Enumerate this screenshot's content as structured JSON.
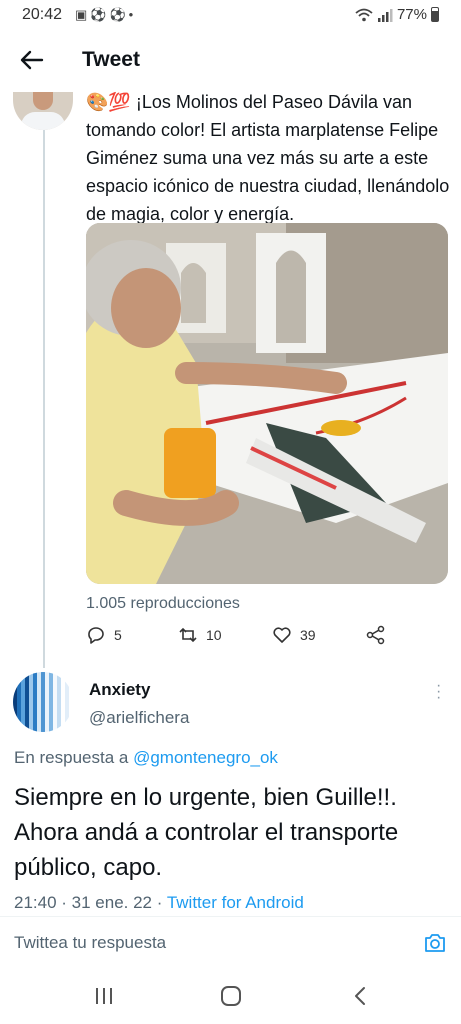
{
  "status_bar": {
    "time": "20:42",
    "left_icons": [
      "image-icon",
      "soccer-ball-icon",
      "soccer-ball-icon",
      "dot-icon"
    ],
    "battery": "77%"
  },
  "header": {
    "title": "Tweet",
    "back_icon": "back-arrow-icon"
  },
  "parent_tweet": {
    "emoji": "🎨💯",
    "text": "¡Los Molinos del Paseo Dávila van tomando color! El artista marplatense Felipe Giménez suma una vez más su arte a este espacio icónico de nuestra ciudad, llenándolo de magia, color y energía.",
    "views": "1.005 reproducciones",
    "replies": "5",
    "retweets": "10",
    "likes": "39"
  },
  "reply_tweet": {
    "name": "Anxiety",
    "handle": "@arielfichera",
    "reply_prefix": "En respuesta a ",
    "reply_to": "@gmontenegro_ok",
    "text": "Siempre en lo urgente, bien Guille!!. Ahora andá a controlar el transporte público, capo.",
    "timestamp": "21:40 · 31 ene. 22 · ",
    "source": "Twitter for Android"
  },
  "reply_box": {
    "placeholder": "Twittea tu respuesta"
  },
  "colors": {
    "accent": "#1d9bf0",
    "secondary_text": "#536471"
  }
}
